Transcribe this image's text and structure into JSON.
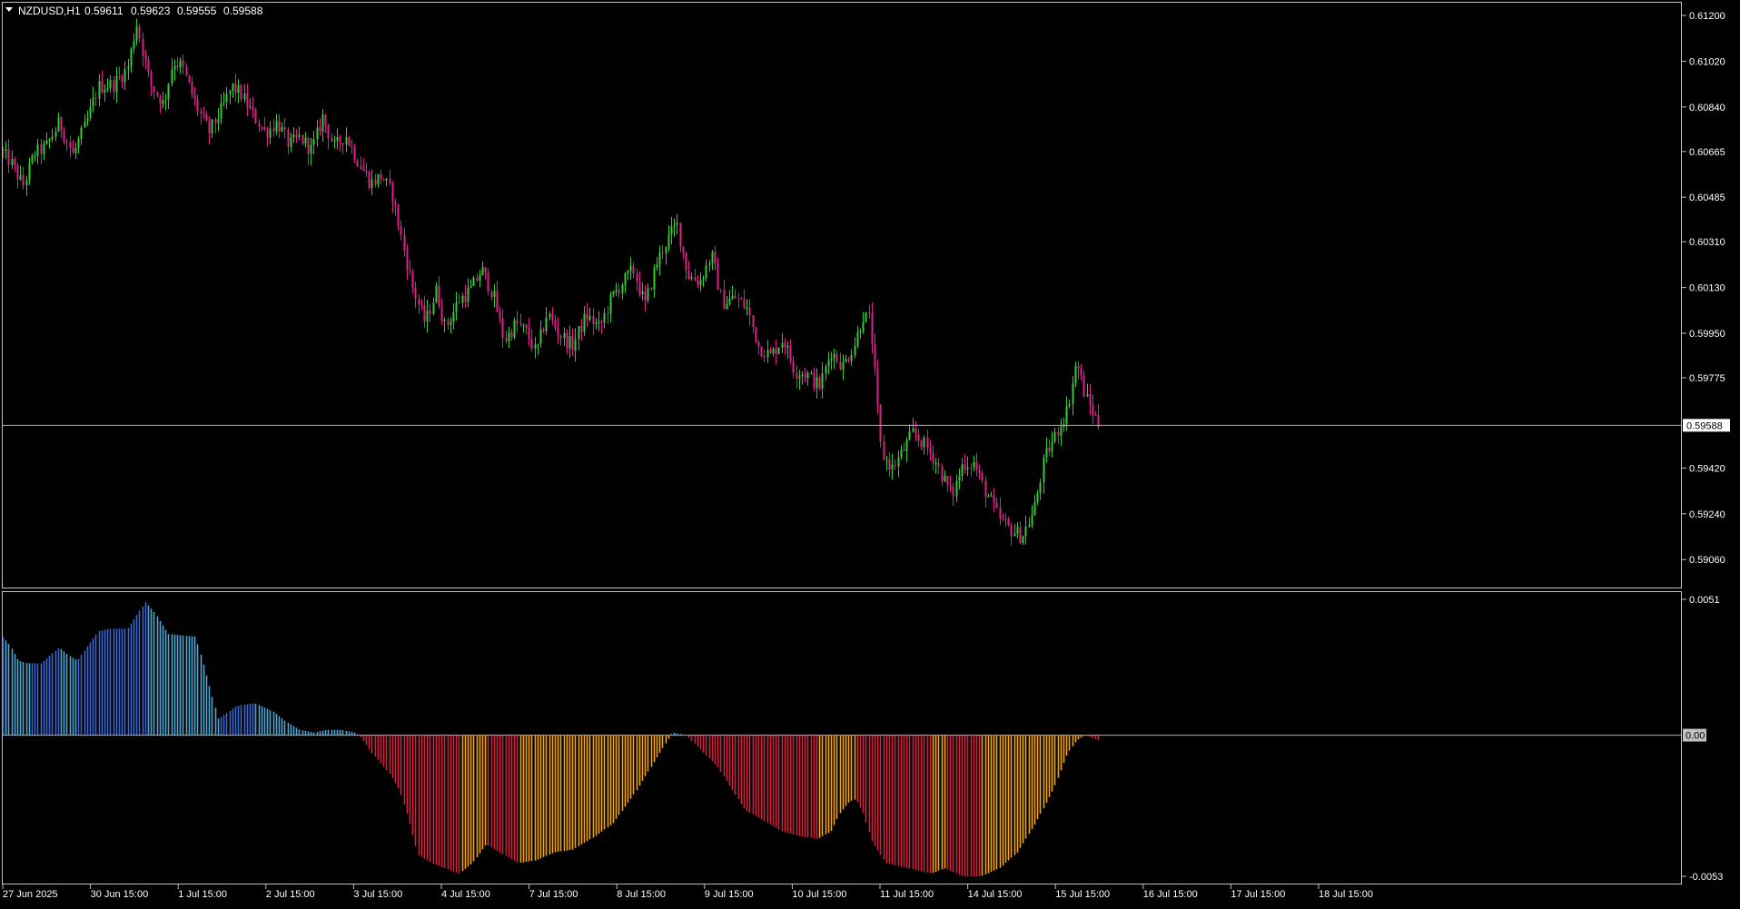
{
  "header": {
    "menu_icon": "triangle-down-icon",
    "symbol": "NZDUSD,H1",
    "open": "0.59611",
    "high": "0.59623",
    "low": "0.59555",
    "close": "0.59588"
  },
  "colors": {
    "background": "#000000",
    "frame": "#c0c0c0",
    "bull": "#32cd32",
    "bear": "#e0208a",
    "hist_pos_strong": "#3a66d8",
    "hist_pos_weak": "#4fa6d8",
    "hist_neg_strong": "#d7203c",
    "hist_neg_weak": "#ffa500",
    "price_line": "#b0b0b0",
    "price_label_bg": "#ffffff",
    "price_label_text": "#000000"
  },
  "chart_data": [
    {
      "type": "candlestick",
      "symbol": "NZDUSD",
      "timeframe": "H1",
      "current_price": "0.59588",
      "ylim": [
        0.5895,
        0.6125
      ],
      "y_ticks": [
        "0.61200",
        "0.61020",
        "0.60840",
        "0.60665",
        "0.60485",
        "0.60310",
        "0.60130",
        "0.59950",
        "0.59775",
        "0.59420",
        "0.59240",
        "0.59060"
      ],
      "path_x": [
        0,
        12,
        25,
        38,
        50,
        65,
        80,
        95,
        108,
        125,
        140,
        150,
        165,
        180,
        190,
        200,
        215,
        230,
        245,
        255,
        265,
        280,
        292,
        305,
        318,
        330,
        343,
        355,
        368,
        380,
        395,
        408,
        420,
        432,
        443,
        455,
        468,
        480,
        490,
        505,
        518,
        530,
        543,
        555,
        568,
        580,
        590,
        602,
        615,
        630,
        645,
        660,
        673,
        685,
        697,
        710,
        722,
        733,
        745,
        757,
        770,
        783,
        795,
        810,
        822,
        835,
        848,
        862,
        875,
        888,
        902,
        915,
        928,
        942,
        950,
        958,
        970,
        982,
        993,
        1005,
        1018,
        1028,
        1037,
        1048,
        1060,
        1072,
        1083,
        1092,
        1100,
        1112,
        1125,
        1138,
        1150,
        1162,
        1175,
        1185,
        1195,
        1210
      ],
      "path_y": [
        0.6067,
        0.6062,
        0.6053,
        0.6066,
        0.6068,
        0.6078,
        0.6065,
        0.6078,
        0.6092,
        0.6093,
        0.6099,
        0.6117,
        0.6093,
        0.6085,
        0.6102,
        0.61,
        0.6085,
        0.6074,
        0.6084,
        0.6092,
        0.6089,
        0.608,
        0.6074,
        0.6078,
        0.6069,
        0.6072,
        0.6067,
        0.608,
        0.6068,
        0.6073,
        0.6062,
        0.6054,
        0.6057,
        0.6049,
        0.603,
        0.6012,
        0.5999,
        0.6012,
        0.5997,
        0.6008,
        0.6012,
        0.602,
        0.601,
        0.5992,
        0.5999,
        0.5995,
        0.5987,
        0.6003,
        0.5995,
        0.599,
        0.6002,
        0.5997,
        0.6009,
        0.6015,
        0.602,
        0.6006,
        0.6022,
        0.6031,
        0.6038,
        0.6018,
        0.6015,
        0.6026,
        0.6007,
        0.6009,
        0.6005,
        0.599,
        0.5986,
        0.5993,
        0.598,
        0.5979,
        0.5974,
        0.5988,
        0.5982,
        0.5992,
        0.6002,
        0.6,
        0.5948,
        0.5942,
        0.5948,
        0.5956,
        0.5951,
        0.5946,
        0.5939,
        0.5931,
        0.5944,
        0.5944,
        0.5934,
        0.5928,
        0.5922,
        0.5918,
        0.5915,
        0.5925,
        0.5946,
        0.5955,
        0.5965,
        0.5984,
        0.597,
        0.5959
      ],
      "h_line": "0.59588"
    },
    {
      "type": "histogram",
      "ylim": [
        -0.0053,
        0.0051
      ],
      "y_ticks": [
        "0.0051",
        "0.00",
        "-0.0053"
      ],
      "current_label": "0.00",
      "path_x": [
        0,
        10,
        20,
        30,
        45,
        55,
        65,
        75,
        85,
        95,
        108,
        120,
        140,
        160,
        170,
        185,
        215,
        225,
        240,
        260,
        280,
        300,
        315,
        330,
        345,
        360,
        375,
        390,
        395,
        410,
        430,
        440,
        450,
        460,
        475,
        490,
        505,
        520,
        535,
        550,
        570,
        590,
        610,
        630,
        655,
        675,
        700,
        720,
        740,
        755,
        770,
        790,
        805,
        820,
        840,
        860,
        880,
        900,
        915,
        925,
        935,
        942,
        950,
        960,
        975,
        1000,
        1025,
        1040,
        1060,
        1080,
        1100,
        1120,
        1140,
        1160,
        1175,
        1185,
        1195,
        1210
      ],
      "path_y": [
        0.0038,
        0.0034,
        0.0028,
        0.0027,
        0.0027,
        0.003,
        0.0033,
        0.003,
        0.0028,
        0.0033,
        0.0039,
        0.004,
        0.004,
        0.005,
        0.0046,
        0.0038,
        0.0037,
        0.0025,
        0.0006,
        0.0011,
        0.0012,
        0.0009,
        0.0005,
        0.0002,
        0.0001,
        0.0002,
        0.0002,
        0.0001,
        0.0,
        -0.0007,
        -0.0015,
        -0.0021,
        -0.0032,
        -0.0045,
        -0.0048,
        -0.005,
        -0.0052,
        -0.0048,
        -0.0041,
        -0.0044,
        -0.0048,
        -0.0047,
        -0.0044,
        -0.0043,
        -0.0038,
        -0.0033,
        -0.0021,
        -0.001,
        0.0001,
        0.0,
        -0.0005,
        -0.0012,
        -0.002,
        -0.0028,
        -0.0032,
        -0.0036,
        -0.0038,
        -0.0039,
        -0.0036,
        -0.0029,
        -0.0025,
        -0.0024,
        -0.0029,
        -0.004,
        -0.0048,
        -0.005,
        -0.0052,
        -0.005,
        -0.0053,
        -0.0053,
        -0.005,
        -0.0044,
        -0.0033,
        -0.002,
        -0.0007,
        -0.0002,
        0.0,
        -0.0002
      ]
    }
  ],
  "x_axis": {
    "labels": [
      "27 Jun 2025",
      "30 Jun 15:00",
      "1 Jul 15:00",
      "2 Jul 15:00",
      "3 Jul 15:00",
      "4 Jul 15:00",
      "7 Jul 15:00",
      "8 Jul 15:00",
      "9 Jul 15:00",
      "10 Jul 15:00",
      "11 Jul 15:00",
      "14 Jul 15:00",
      "15 Jul 15:00",
      "16 Jul 15:00",
      "17 Jul 15:00",
      "18 Jul 15:00"
    ]
  }
}
